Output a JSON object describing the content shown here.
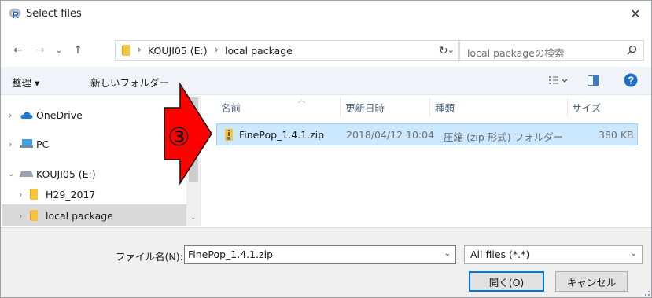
{
  "window": {
    "title": "Select files",
    "close_label": "✕"
  },
  "address": {
    "crumbs": [
      "KOUJI05 (E:)",
      "local package"
    ],
    "search_placeholder": "local packageの検索"
  },
  "toolbar": {
    "organize_label": "整理 ▾",
    "new_folder_label": "新しいフォルダー"
  },
  "nav": {
    "items": [
      {
        "label": "OneDrive"
      },
      {
        "label": "PC"
      },
      {
        "label": "KOUJI05 (E:)"
      },
      {
        "label": "H29_2017"
      },
      {
        "label": "local package"
      }
    ]
  },
  "files": {
    "columns": [
      "名前",
      "更新日時",
      "種類",
      "サイズ"
    ],
    "rows": [
      {
        "name": "FinePop_1.4.1.zip",
        "modified": "2018/04/12 10:04",
        "type": "圧縮 (zip 形式) フォルダー",
        "size": "380 KB"
      }
    ]
  },
  "bottom": {
    "filename_label": "ファイル名(N):",
    "filename_value": "FinePop_1.4.1.zip",
    "filetype_value": "All files (*.*)",
    "open_label": "開く(O)",
    "cancel_label": "キャンセル"
  },
  "annotation": {
    "step_number": "③"
  },
  "colors": {
    "selection": "#cce8ff",
    "accent": "#0078d7",
    "annotation_red": "#ff0000"
  }
}
